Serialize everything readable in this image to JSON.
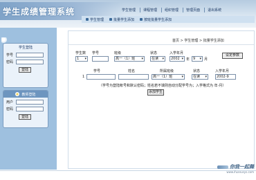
{
  "header": {
    "site_title": "学生成绩管理系统",
    "top_menu": [
      "学生管理",
      "课程管理",
      "组织管理",
      "管理页面",
      "退出系统"
    ],
    "sub_tabs": [
      "学生管理",
      "批量学生添加",
      "按班批量学生添加"
    ]
  },
  "sidebar": {
    "student_login": {
      "title": "学生登陆",
      "id_label": "学号",
      "password_label": "密码",
      "button": "登陆"
    },
    "teacher_login": {
      "title": "教师登陆",
      "user_label": "用户",
      "password_label": "密码",
      "button": "登陆"
    }
  },
  "main": {
    "breadcrumb": "首页 > 学生管理 > 批量学生添加",
    "row1": {
      "labels": {
        "count": "学生数",
        "id": "学号",
        "class": "班级",
        "status": "状态",
        "enroll": "入学年月"
      },
      "count_value": "1",
      "id_value": "",
      "class_value": "高一（1）班",
      "status_value": "在读",
      "year_value": "2002",
      "year_unit": "年",
      "month_value": "9",
      "month_unit": "月",
      "set_button": "设定参数"
    },
    "row2": {
      "labels": {
        "id": "学号",
        "name": "姓名",
        "class": "所属班级",
        "status": "状态",
        "enroll": "入学年月"
      },
      "row_number": "1",
      "id_value": "",
      "name_value": "",
      "class_value": "高一（1）班",
      "status_value": "在读",
      "enroll_value": "2002-9"
    },
    "note": "（学号为登陆帐号和默认密码；姓名若不填则自动分配学号为；入学格式为 年-月）",
    "add_button": "添加学生"
  },
  "watermark": {
    "logo": "你我一起舞",
    "url": "www.ifuanusys.com"
  }
}
